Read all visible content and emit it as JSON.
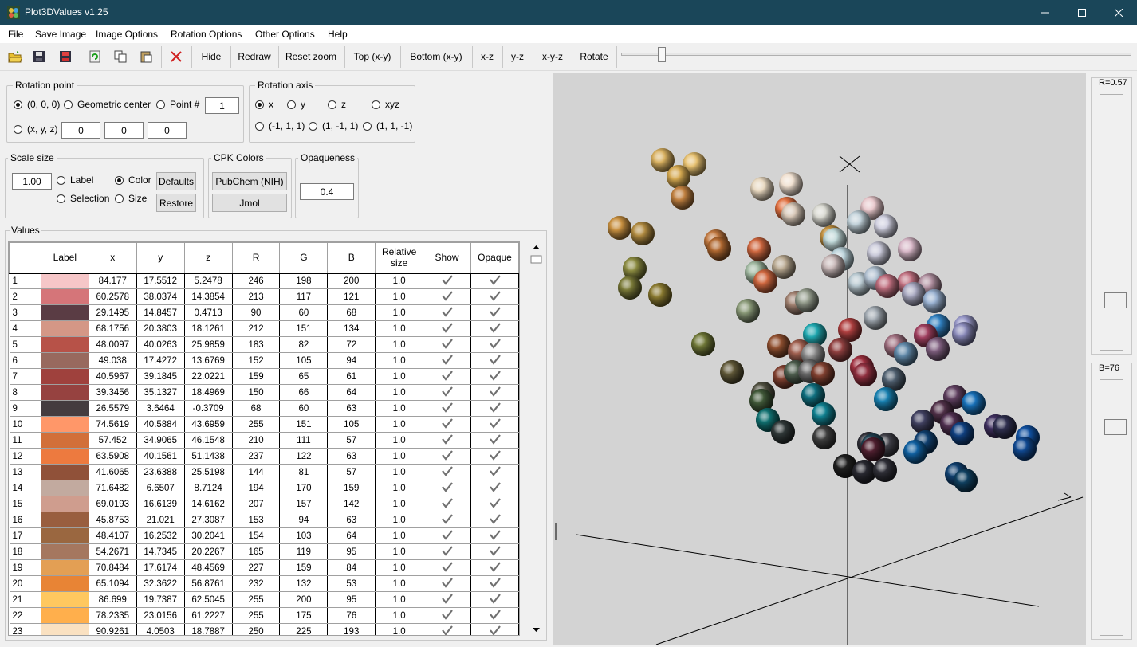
{
  "window": {
    "title": "Plot3DValues v1.25"
  },
  "menu": [
    "File",
    "Save Image",
    "Image Options",
    "Rotation Options",
    "Other Options",
    "Help"
  ],
  "toolbar": {
    "buttons": [
      "Hide",
      "Redraw",
      "Reset zoom",
      "Top (x-y)",
      "Bottom (x-y)",
      "x-z",
      "y-z",
      "x-y-z",
      "Rotate"
    ],
    "icons": [
      "open-folder-icon",
      "save-icon",
      "save-red-icon",
      "refresh-icon",
      "copy-icon",
      "paste-icon",
      "delete-x-icon"
    ]
  },
  "rotation_point": {
    "legend": "Rotation point",
    "options": [
      "(0, 0, 0)",
      "Geometric center",
      "Point #",
      "(x, y, z)"
    ],
    "selected": "(0, 0, 0)",
    "point_number": "1",
    "xyz": [
      "0",
      "0",
      "0"
    ]
  },
  "rotation_axis": {
    "legend": "Rotation axis",
    "options": [
      "x",
      "y",
      "z",
      "xyz",
      "(-1, 1, 1)",
      "(1, -1, 1)",
      "(1, 1, -1)"
    ],
    "selected": "x"
  },
  "scale_size": {
    "legend": "Scale size",
    "value": "1.00",
    "options": [
      "Label",
      "Color",
      "Selection",
      "Size"
    ],
    "selected": "Color",
    "defaults_label": "Defaults",
    "restore_label": "Restore"
  },
  "cpk_colors": {
    "legend": "CPK Colors",
    "pubchem_label": "PubChem (NIH)",
    "jmol_label": "Jmol"
  },
  "opaqueness": {
    "legend": "Opaqueness",
    "value": "0.4"
  },
  "values": {
    "legend": "Values",
    "columns": [
      "Label",
      "x",
      "y",
      "z",
      "R",
      "G",
      "B",
      "Relative size",
      "Show",
      "Opaque"
    ],
    "rows": [
      [
        "1",
        "84.177",
        "17.5512",
        "5.2478",
        "246",
        "198",
        "200",
        "1.0"
      ],
      [
        "2",
        "60.2578",
        "38.0374",
        "14.3854",
        "213",
        "117",
        "121",
        "1.0"
      ],
      [
        "3",
        "29.1495",
        "14.8457",
        "0.4713",
        "90",
        "60",
        "68",
        "1.0"
      ],
      [
        "4",
        "68.1756",
        "20.3803",
        "18.1261",
        "212",
        "151",
        "134",
        "1.0"
      ],
      [
        "5",
        "48.0097",
        "40.0263",
        "25.9859",
        "183",
        "82",
        "72",
        "1.0"
      ],
      [
        "6",
        "49.038",
        "17.4272",
        "13.6769",
        "152",
        "105",
        "94",
        "1.0"
      ],
      [
        "7",
        "40.5967",
        "39.1845",
        "22.0221",
        "159",
        "65",
        "61",
        "1.0"
      ],
      [
        "8",
        "39.3456",
        "35.1327",
        "18.4969",
        "150",
        "66",
        "64",
        "1.0"
      ],
      [
        "9",
        "26.5579",
        "3.6464",
        "-0.3709",
        "68",
        "60",
        "63",
        "1.0"
      ],
      [
        "10",
        "74.5619",
        "40.5884",
        "43.6959",
        "255",
        "151",
        "105",
        "1.0"
      ],
      [
        "11",
        "57.452",
        "34.9065",
        "46.1548",
        "210",
        "111",
        "57",
        "1.0"
      ],
      [
        "12",
        "63.5908",
        "40.1561",
        "51.1438",
        "237",
        "122",
        "63",
        "1.0"
      ],
      [
        "13",
        "41.6065",
        "23.6388",
        "25.5198",
        "144",
        "81",
        "57",
        "1.0"
      ],
      [
        "14",
        "71.6482",
        "6.6507",
        "8.7124",
        "194",
        "170",
        "159",
        "1.0"
      ],
      [
        "15",
        "69.0193",
        "16.6139",
        "14.6162",
        "207",
        "157",
        "142",
        "1.0"
      ],
      [
        "16",
        "45.8753",
        "21.021",
        "27.3087",
        "153",
        "94",
        "63",
        "1.0"
      ],
      [
        "17",
        "48.4107",
        "16.2532",
        "30.2041",
        "154",
        "103",
        "64",
        "1.0"
      ],
      [
        "18",
        "54.2671",
        "14.7345",
        "20.2267",
        "165",
        "119",
        "95",
        "1.0"
      ],
      [
        "19",
        "70.8484",
        "17.6174",
        "48.4569",
        "227",
        "159",
        "84",
        "1.0"
      ],
      [
        "20",
        "65.1094",
        "32.3622",
        "56.8761",
        "232",
        "132",
        "53",
        "1.0"
      ],
      [
        "21",
        "86.699",
        "19.7387",
        "62.5045",
        "255",
        "200",
        "95",
        "1.0"
      ],
      [
        "22",
        "78.2335",
        "23.0156",
        "61.2227",
        "255",
        "175",
        "76",
        "1.0"
      ],
      [
        "23",
        "90.9261",
        "4.0503",
        "18.7887",
        "250",
        "225",
        "193",
        "1.0"
      ]
    ]
  },
  "sliders": {
    "r_label": "R=0.57",
    "r_value": 0.57,
    "b_label": "B=76",
    "b_value": 76
  },
  "spheres": [
    {
      "c": "#d8b060"
    },
    {
      "c": "#e6c070"
    },
    {
      "c": "#d4a850"
    },
    {
      "c": "#c08040"
    },
    {
      "c": "#c89040"
    },
    {
      "c": "#e8d8c0"
    },
    {
      "c": "#f0e0d0"
    },
    {
      "c": "#e07040"
    },
    {
      "c": "#d8c8b8"
    },
    {
      "c": "#d8d8d0"
    },
    {
      "c": "#e8c8cc"
    },
    {
      "c": "#c0d0d8"
    },
    {
      "c": "#d0d0e0"
    },
    {
      "c": "#c09040"
    },
    {
      "c": "#b08020"
    }
  ]
}
